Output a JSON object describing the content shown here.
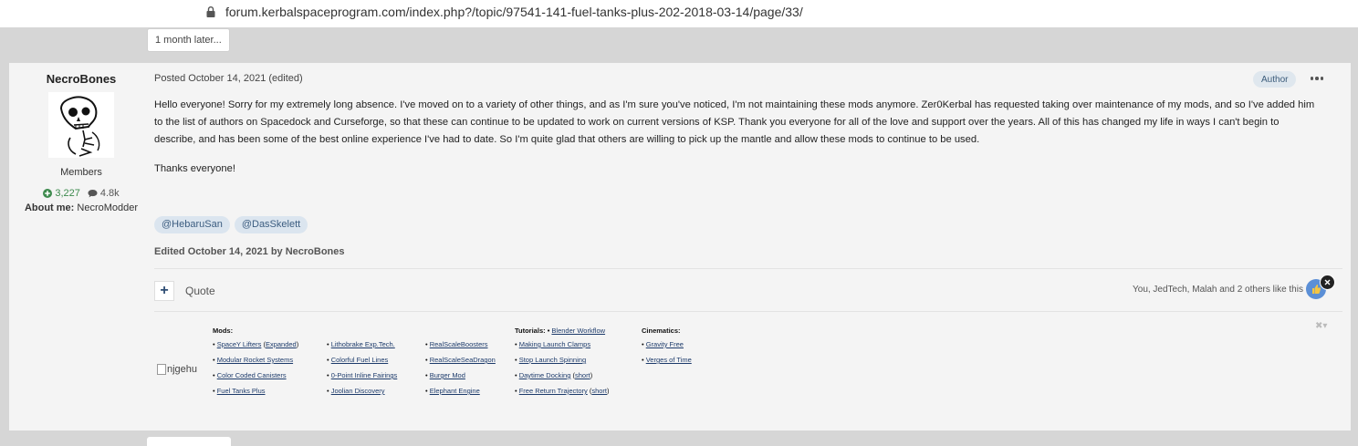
{
  "browser": {
    "url": "forum.kerbalspaceprogram.com/index.php?/topic/97541-141-fuel-tanks-plus-202-2018-03-14/page/33/"
  },
  "time_gap": "1 month later...",
  "author": {
    "name": "NecroBones",
    "group": "Members",
    "reputation": "3,227",
    "posts": "4.8k",
    "about_label": "About me:",
    "about_value": "NecroModder"
  },
  "post": {
    "posted": "Posted October 14, 2021 (edited)",
    "author_badge": "Author",
    "body": "Hello everyone! Sorry for my extremely long absence. I've moved on to a variety of other things, and as I'm sure you've noticed, I'm not maintaining these mods anymore. Zer0Kerbal has requested taking over maintenance of my mods, and so I've added him to the list of authors on Spacedock and Curseforge, so that these can continue to be updated to work on current versions of KSP. Thank you everyone for all of the love and support over the years. All of this has changed my life in ways I can't begin to describe, and has been some of the best online experience I've had to date. So I'm quite glad that others are willing to pick up the mantle and allow these mods to continue to be used.",
    "thanks": "Thanks everyone!",
    "mentions": [
      "@HebaruSan",
      "@DasSkelett"
    ],
    "edited_prefix": "Edited",
    "edited_date": "October 14, 2021",
    "edited_by": "by NecroBones",
    "quote_label": "Quote",
    "likes_text": "You, JedTech, Malah and 2 others like this"
  },
  "signature": {
    "image_alt": "njgehu",
    "mods_heading": "Mods:",
    "col1": [
      {
        "pre": "• ",
        "link": "SpaceY Lifters",
        "mid": " (",
        "link2": "Expanded",
        "post": ")"
      },
      {
        "pre": "• ",
        "link": "Modular Rocket Systems"
      },
      {
        "pre": "• ",
        "link": "Color Coded Canisters"
      },
      {
        "pre": "• ",
        "link": "Fuel Tanks Plus"
      }
    ],
    "col2": [
      {
        "pre": "• ",
        "link": "Lithobrake Exp.Tech."
      },
      {
        "pre": "• ",
        "link": "Colorful Fuel Lines"
      },
      {
        "pre": "• ",
        "link": "0-Point Inline Fairings"
      },
      {
        "pre": "• ",
        "link": "Joolian Discovery"
      }
    ],
    "col3": [
      {
        "pre": "• ",
        "link": "RealScaleBoosters"
      },
      {
        "pre": "• ",
        "link": "RealScaleSeaDragon"
      },
      {
        "pre": "• ",
        "link": "Burger Mod"
      },
      {
        "pre": "• ",
        "link": "Elephant Engine"
      }
    ],
    "tutorials_heading": "Tutorials:",
    "tutorials_first": "Blender Workflow",
    "col4": [
      {
        "pre": "• ",
        "link": "Making Launch Clamps"
      },
      {
        "pre": "• ",
        "link": "Stop Launch Spinning"
      },
      {
        "pre": "• ",
        "link": "Daytime Docking",
        "mid": " (",
        "link2": "short",
        "post": ")"
      },
      {
        "pre": "• ",
        "link": "Free Return Trajectory",
        "mid": " (",
        "link2": "short",
        "post": ")"
      }
    ],
    "cinematics_heading": "Cinematics:",
    "col5": [
      {
        "pre": "• ",
        "link": "Gravity Free"
      },
      {
        "pre": "• ",
        "link": "Verges of Time"
      }
    ]
  },
  "colors": {
    "background": "#d6d6d6",
    "post_bg": "#f4f4f4",
    "link": "#1d3b6b",
    "reputation": "#3d8a4d",
    "accent": "#2e4d73"
  }
}
